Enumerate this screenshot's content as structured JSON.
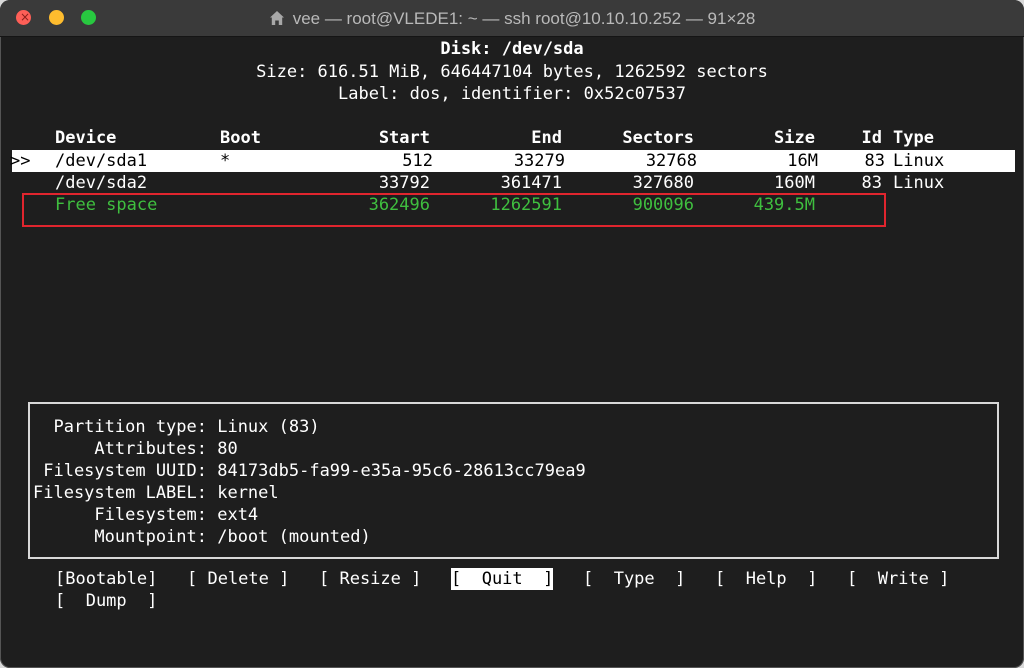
{
  "window": {
    "title": "vee — root@VLEDE1: ~ — ssh root@10.10.10.252 — 91×28",
    "close_glyph": "×"
  },
  "disk": {
    "heading": "Disk: /dev/sda",
    "size_line": "Size: 616.51 MiB, 646447104 bytes, 1262592 sectors",
    "label_line": "Label: dos, identifier: 0x52c07537"
  },
  "table": {
    "headers": {
      "device": "Device",
      "boot": "Boot",
      "start": "Start",
      "end": "End",
      "sectors": "Sectors",
      "size": "Size",
      "id": "Id",
      "type": "Type"
    },
    "rows": [
      {
        "marker": ">>",
        "device": "/dev/sda1",
        "boot": "*",
        "start": "512",
        "end": "33279",
        "sectors": "32768",
        "size": "16M",
        "id": "83",
        "type": "Linux"
      },
      {
        "marker": "",
        "device": "/dev/sda2",
        "boot": "",
        "start": "33792",
        "end": "361471",
        "sectors": "327680",
        "size": "160M",
        "id": "83",
        "type": "Linux"
      },
      {
        "marker": "",
        "device": "Free space",
        "boot": "",
        "start": "362496",
        "end": "1262591",
        "sectors": "900096",
        "size": "439.5M",
        "id": "",
        "type": ""
      }
    ]
  },
  "info": {
    "lines": [
      "  Partition type: Linux (83)",
      "      Attributes: 80",
      " Filesystem UUID: 84173db5-fa99-e35a-95c6-28613cc79ea9",
      "Filesystem LABEL: kernel",
      "      Filesystem: ext4",
      "      Mountpoint: /boot (mounted)"
    ]
  },
  "menu": {
    "bootable": "[Bootable]",
    "delete": "[ Delete ]",
    "resize": "[ Resize ]",
    "quit": "[  Quit  ]",
    "type": "[  Type  ]",
    "help": "[  Help  ]",
    "write": "[  Write ]",
    "dump": "[  Dump  ]",
    "selected": "quit"
  },
  "colors": {
    "background": "#1e1e1e",
    "free_space": "#3fbf3f",
    "highlight_box": "#e0252e"
  }
}
